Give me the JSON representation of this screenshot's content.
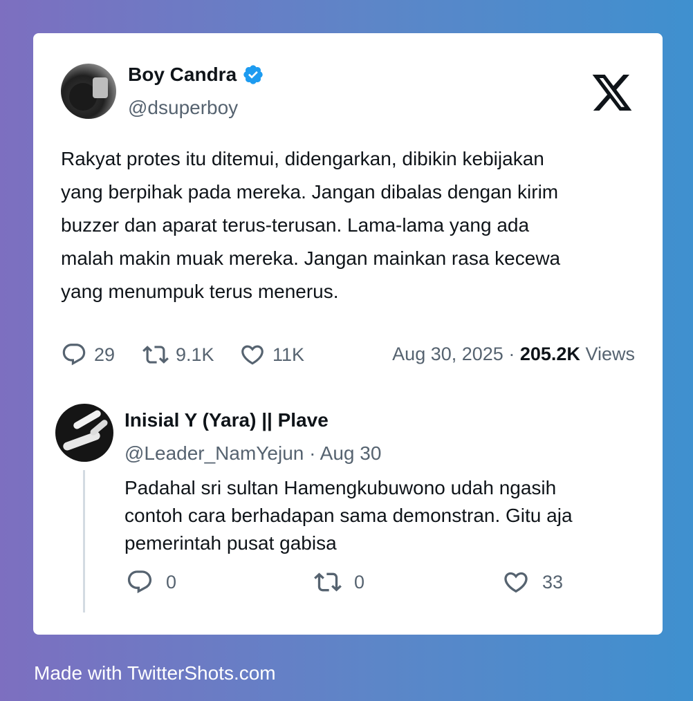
{
  "tweet": {
    "author_name": "Boy Candra",
    "handle": "@dsuperboy",
    "text": "Rakyat protes itu ditemui, didengarkan, dibikin kebijakan\nyang berpihak pada mereka. Jangan dibalas dengan kirim\nbuzzer dan aparat terus-terusan. Lama-lama yang ada\nmalah makin muak mereka. Jangan mainkan rasa kecewa\nyang menumpuk terus menerus.",
    "replies": "29",
    "retweets": "9.1K",
    "likes": "11K",
    "date": "Aug 30, 2025",
    "separator": "·",
    "views_count": "205.2K",
    "views_label": "Views"
  },
  "reply": {
    "author_name": "Inisial Y (Yara) || Plave",
    "handle_date": "@Leader_NamYejun · Aug 30",
    "text": "Padahal sri sultan Hamengkubuwono udah ngasih\ncontoh cara berhadapan sama demonstran. Gitu aja\npemerintah pusat gabisa",
    "replies": "0",
    "retweets": "0",
    "likes": "33"
  },
  "footer": "Made with TwitterShots.com",
  "icons": {
    "verified": "verified-badge-icon",
    "x_logo": "x-logo-icon",
    "reply": "reply-icon",
    "retweet": "retweet-icon",
    "like": "heart-icon"
  },
  "colors": {
    "verified": "#1d9bf0",
    "text": "#0f1419",
    "muted": "#566370",
    "background_start": "#7d6fc0",
    "background_end": "#3f90cf"
  }
}
